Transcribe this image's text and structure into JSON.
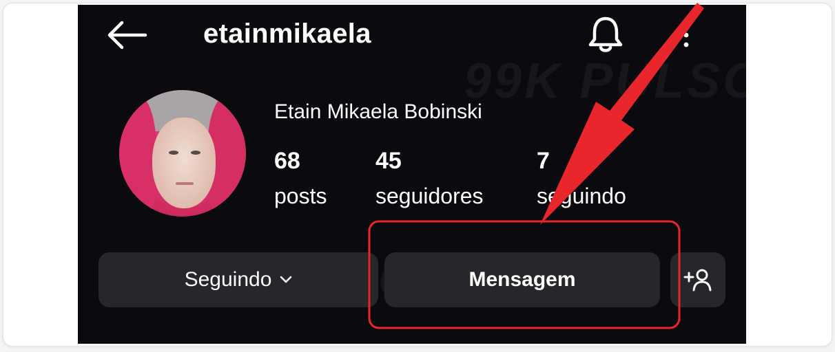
{
  "header": {
    "username": "etainmikaela",
    "back_icon": "arrow-left-icon",
    "bell_icon": "bell-icon",
    "more_icon": "vertical-dots-icon"
  },
  "profile": {
    "full_name": "Etain Mikaela Bobinski",
    "stats": [
      {
        "value": "68",
        "label": "posts"
      },
      {
        "value": "45",
        "label": "seguidores"
      },
      {
        "value": "7",
        "label": "seguindo"
      }
    ]
  },
  "actions": {
    "following_label": "Seguindo",
    "message_label": "Mensagem",
    "add_person_icon": "add-person-icon"
  },
  "annotation": {
    "highlight_color": "#e8262c",
    "arrow_color": "#e8262c"
  },
  "colors": {
    "screen_bg": "#0b0b0f",
    "button_bg": "#26272b",
    "text": "#ffffff"
  }
}
